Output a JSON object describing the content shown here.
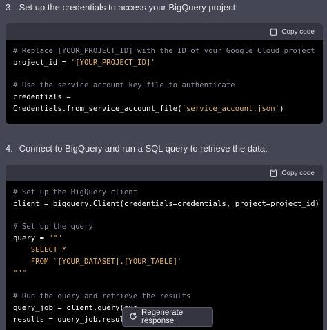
{
  "steps": [
    {
      "number": "3.",
      "text": "Set up the credentials to access your BigQuery project:",
      "copy_label": "Copy code",
      "code": [
        [
          {
            "t": "c",
            "v": "# Replace [YOUR_PROJECT_ID] with the ID of your Google Cloud project"
          }
        ],
        [
          {
            "t": "p",
            "v": "project_id = "
          },
          {
            "t": "s",
            "v": "'[YOUR_PROJECT_ID]'"
          }
        ],
        [],
        [
          {
            "t": "c",
            "v": "# Use the service account key file to authenticate"
          }
        ],
        [
          {
            "t": "p",
            "v": "credentials ="
          }
        ],
        [
          {
            "t": "p",
            "v": "Credentials.from_service_account_file("
          },
          {
            "t": "s",
            "v": "'service_account.json'"
          },
          {
            "t": "p",
            "v": ")"
          }
        ]
      ]
    },
    {
      "number": "4.",
      "text": "Connect to BigQuery and run a SQL query to retrieve the data:",
      "copy_label": "Copy code",
      "code": [
        [
          {
            "t": "c",
            "v": "# Set up the BigQuery client"
          }
        ],
        [
          {
            "t": "p",
            "v": "client = bigquery.Client(credentials=credentials, project=project_id)"
          }
        ],
        [],
        [
          {
            "t": "c",
            "v": "# Set up the query"
          }
        ],
        [
          {
            "t": "p",
            "v": "query = "
          },
          {
            "t": "s",
            "v": "\"\"\""
          }
        ],
        [
          {
            "t": "s",
            "v": "    SELECT *"
          }
        ],
        [
          {
            "t": "s",
            "v": "    FROM `[YOUR_DATASET].[YOUR_TABLE]`"
          }
        ],
        [
          {
            "t": "s",
            "v": "\"\"\""
          }
        ],
        [],
        [
          {
            "t": "c",
            "v": "# Run the query and retrieve the results"
          }
        ],
        [
          {
            "t": "p",
            "v": "query_job = client.query(que"
          }
        ],
        [
          {
            "t": "p",
            "v": "results = query_job.result("
          }
        ]
      ]
    }
  ],
  "regenerate_label": "Regenerate response"
}
